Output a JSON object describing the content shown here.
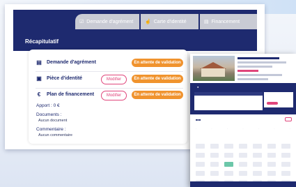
{
  "tabs": [
    {
      "icon": "☑",
      "label": "Demande d'agrément"
    },
    {
      "icon": "☝",
      "label": "Carte d'identité"
    },
    {
      "icon": "▤",
      "label": "Financement"
    }
  ],
  "title": "Récapitulatif",
  "rows": [
    {
      "icon": "▤",
      "label": "Demande d'agrément",
      "status": "En attente de validation"
    },
    {
      "icon": "▣",
      "label": "Pièce d'identité",
      "modify": "Modifier",
      "status": "En attente de validation"
    },
    {
      "icon": "€",
      "label": "Plan de financement",
      "modify": "Modifier",
      "status": "En attente de validation"
    }
  ],
  "apport": "Apport : 0 €",
  "documents_label": "Documents :",
  "documents_value": "Aucun document",
  "comment_label": "Commentaire :",
  "comment_value": "Aucun commentaire",
  "colors": {
    "navy": "#1e2a6f",
    "orange": "#f0932e",
    "pink": "#e0457b",
    "tab_grey": "#c9cbd4"
  }
}
